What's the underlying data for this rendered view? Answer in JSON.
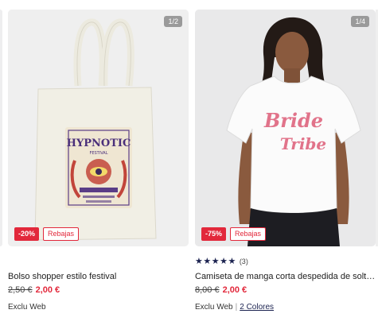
{
  "products": [
    {
      "image_counter": "1/2",
      "discount_badge": "-20%",
      "sale_badge": "Rebajas",
      "title": "Bolso shopper estilo festival",
      "old_price": "2,50 €",
      "new_price": "2,00 €",
      "tag": "Exclu Web",
      "image_print": {
        "line1": "HYPNOTIC",
        "line2": "FESTIVAL"
      }
    },
    {
      "image_counter": "1/4",
      "discount_badge": "-75%",
      "sale_badge": "Rebajas",
      "rating_stars": "★★★★★",
      "rating_count": "(3)",
      "title": "Camiseta de manga corta despedida de solte…",
      "old_price": "8,00 €",
      "new_price": "2,00 €",
      "tag": "Exclu Web",
      "separator": "|",
      "colors_link": "2 Colores",
      "image_print": {
        "line1": "Bride",
        "line2": "Tribe"
      }
    }
  ],
  "colors": {
    "sale_red": "#e2283b",
    "star_navy": "#1b2250",
    "image_bg": "#eeeeee"
  }
}
